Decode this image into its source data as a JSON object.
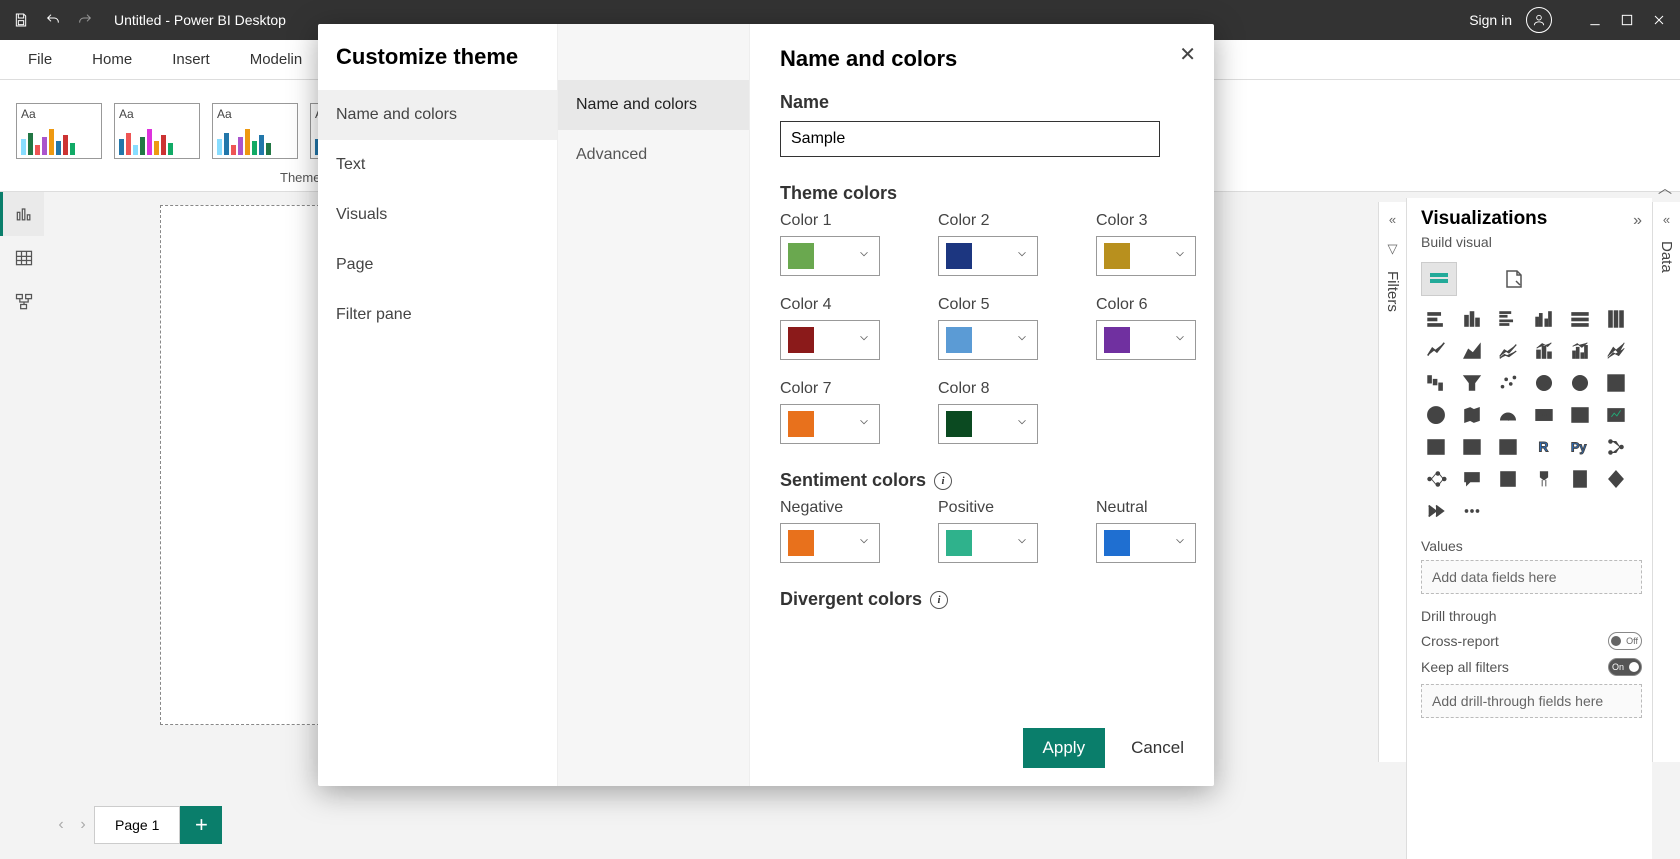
{
  "titlebar": {
    "title": "Untitled - Power BI Desktop",
    "signin": "Sign in"
  },
  "ribbon": {
    "tabs": [
      "File",
      "Home",
      "Insert",
      "Modelin"
    ]
  },
  "themes_label": "Themes",
  "view_rail": {
    "items": [
      "report",
      "table",
      "model"
    ]
  },
  "page_tabs": {
    "page": "Page 1"
  },
  "viz": {
    "title": "Visualizations",
    "subtitle": "Build visual",
    "values_label": "Values",
    "values_placeholder": "Add data fields here",
    "drill_label": "Drill through",
    "cross_report": "Cross-report",
    "cross_report_state": "Off",
    "keep_filters": "Keep all filters",
    "keep_filters_state": "On",
    "drill_placeholder": "Add drill-through fields here"
  },
  "filters_label": "Filters",
  "data_label": "Data",
  "dialog": {
    "title": "Customize theme",
    "close": "✕",
    "col1": [
      "Name and colors",
      "Text",
      "Visuals",
      "Page",
      "Filter pane"
    ],
    "col2": [
      "Name and colors",
      "Advanced"
    ],
    "panel_title": "Name and colors",
    "name_label": "Name",
    "name_value": "Sample",
    "theme_colors_label": "Theme colors",
    "colors": [
      {
        "label": "Color 1",
        "hex": "#6aa84f"
      },
      {
        "label": "Color 2",
        "hex": "#1c3680"
      },
      {
        "label": "Color 3",
        "hex": "#b8901e"
      },
      {
        "label": "Color 4",
        "hex": "#8b1a1a"
      },
      {
        "label": "Color 5",
        "hex": "#5b9bd5"
      },
      {
        "label": "Color 6",
        "hex": "#7030a0"
      },
      {
        "label": "Color 7",
        "hex": "#e8711c"
      },
      {
        "label": "Color 8",
        "hex": "#0b4a21"
      }
    ],
    "sentiment_label": "Sentiment colors",
    "sentiment": [
      {
        "label": "Negative",
        "hex": "#e8711c"
      },
      {
        "label": "Positive",
        "hex": "#2fb28c"
      },
      {
        "label": "Neutral",
        "hex": "#1f6fd1"
      }
    ],
    "divergent_label": "Divergent colors",
    "apply": "Apply",
    "cancel": "Cancel"
  }
}
